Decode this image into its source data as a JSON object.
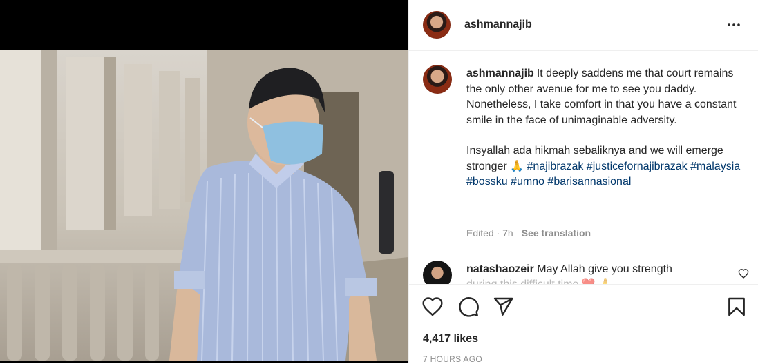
{
  "post": {
    "username": "ashmannajib",
    "caption_text": "It deeply saddens me that court remains the only other avenue for me to see you daddy. Nonetheless, I take comfort in that you have a constant smile in the face of unimaginable adversity.",
    "caption_text_2": "Insyallah ada hikmah sebaliknya and we will emerge stronger 🙏",
    "hashtags": [
      "#najibrazak",
      "#justicefornajibrazak",
      "#malaysia",
      "#bossku",
      "#umno",
      "#barisannasional"
    ],
    "meta": "Edited · 7h",
    "see_translation": "See translation"
  },
  "comment": {
    "username": "natashaozeir",
    "text": "May Allah give you strength",
    "faded_text": "during this difficult time ❤️ 🙏"
  },
  "stats": {
    "likes": "4,417 likes",
    "time": "7 HOURS AGO"
  },
  "icons": [
    "more-icon",
    "heart-icon",
    "comment-icon",
    "share-icon",
    "bookmark-icon"
  ],
  "colors": {
    "hashtag": "#00376b",
    "muted": "#8e8e8e",
    "text": "#262626"
  }
}
